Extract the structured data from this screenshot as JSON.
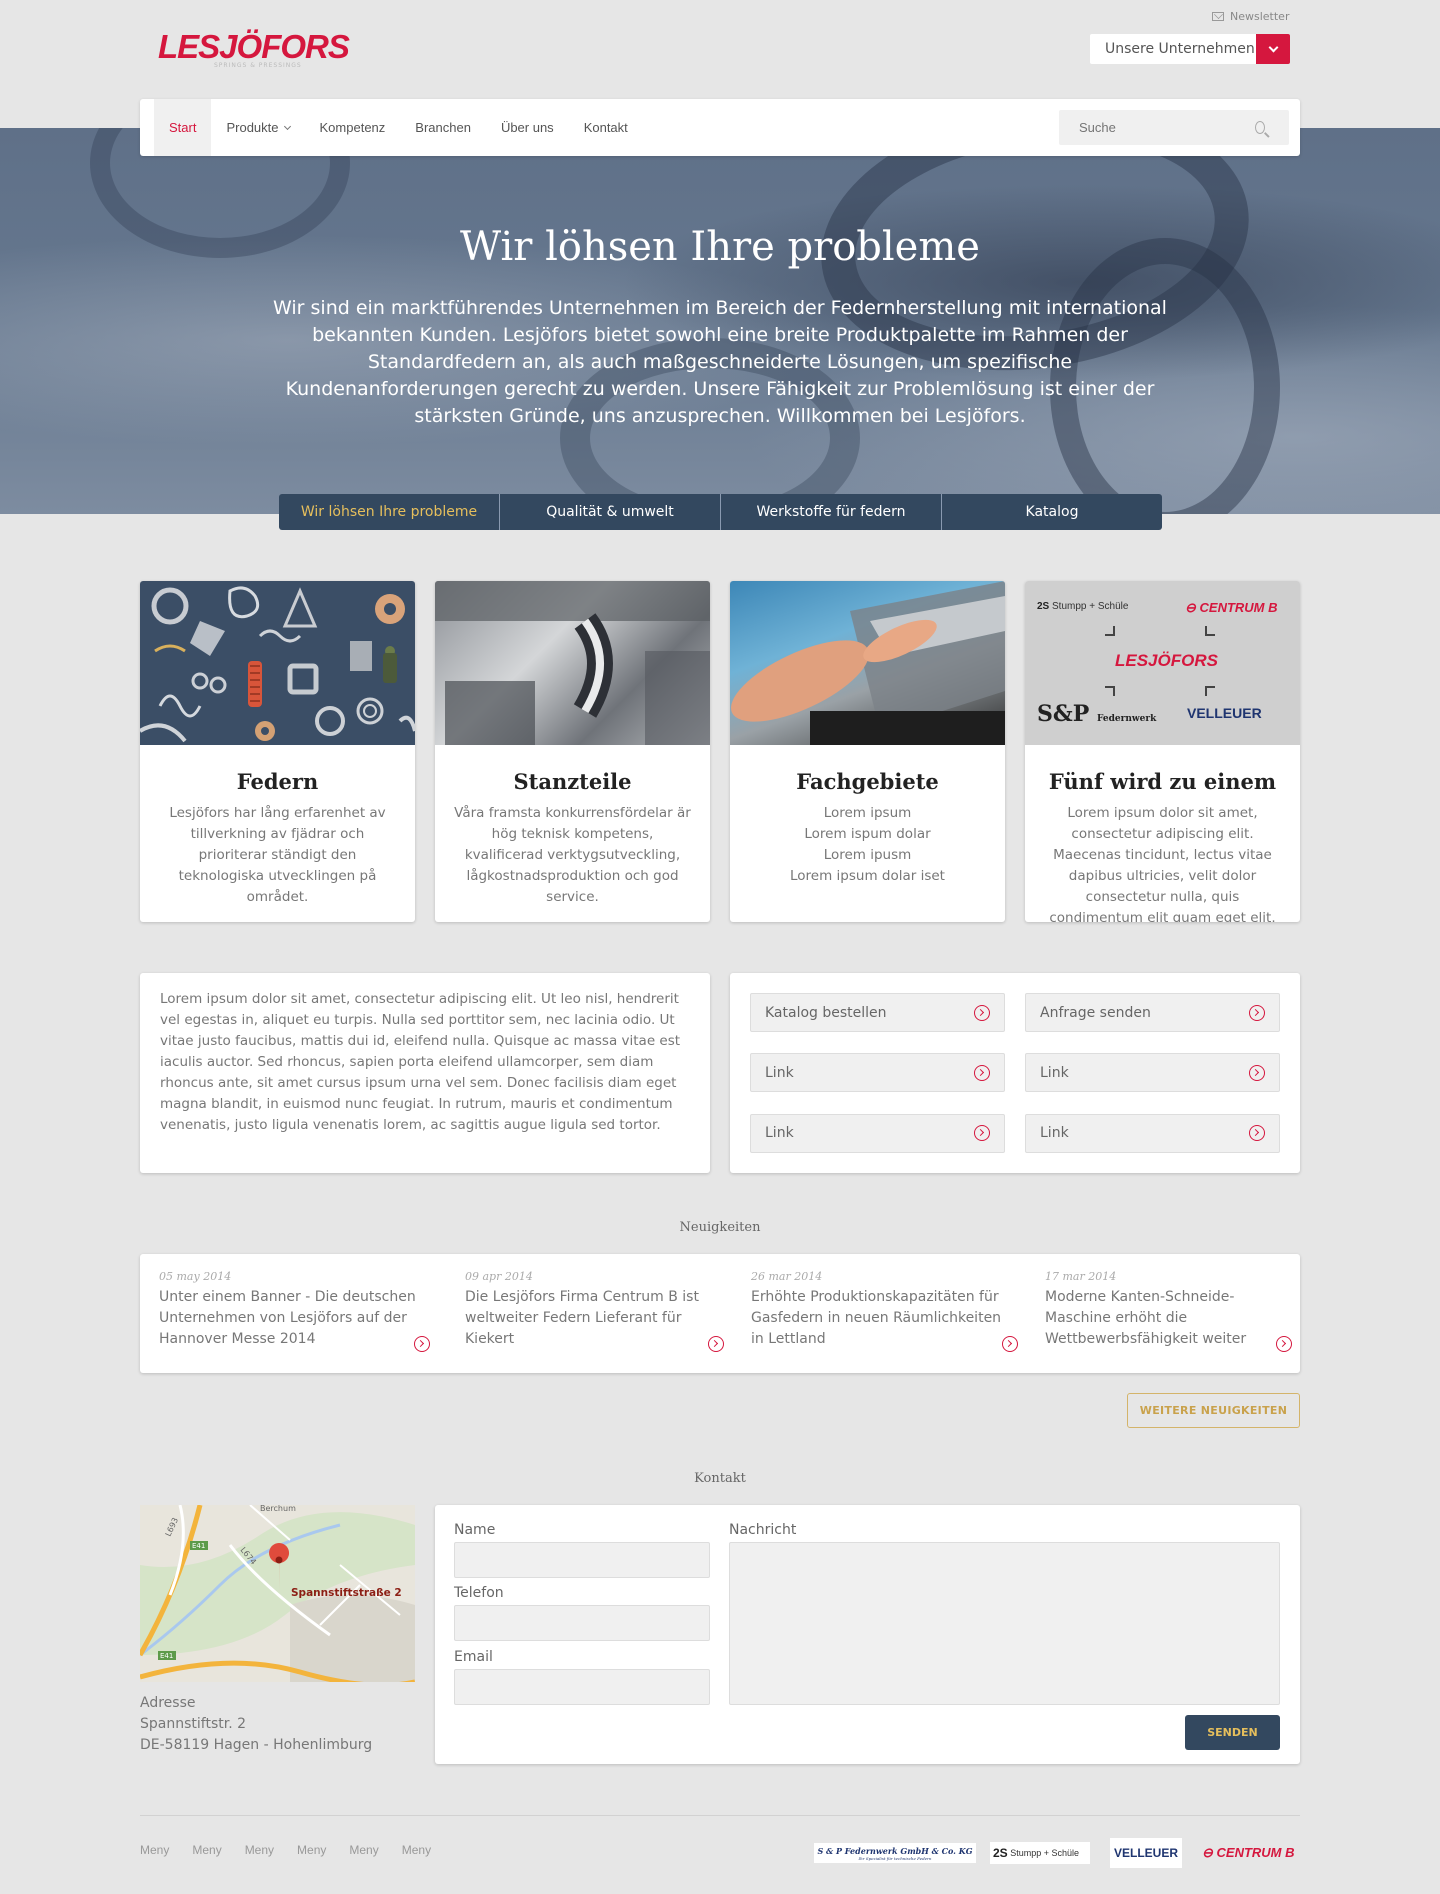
{
  "header": {
    "newsletter": "Newsletter",
    "logo_text": "LESJÖFORS",
    "logo_tagline": "SPRINGS & PRESSINGS",
    "companies_label": "Unsere Unternehmen"
  },
  "nav": {
    "items": [
      {
        "label": "Start",
        "active": true
      },
      {
        "label": "Produkte",
        "dropdown": true
      },
      {
        "label": "Kompetenz"
      },
      {
        "label": "Branchen"
      },
      {
        "label": "Über uns"
      },
      {
        "label": "Kontakt"
      }
    ],
    "search_placeholder": "Suche"
  },
  "hero": {
    "title": "Wir löhsen Ihre probleme",
    "text": "Wir sind ein marktführendes Unternehmen im Bereich der Federnherstellung mit international bekannten Kunden. Lesjöfors bietet sowohl eine breite Produktpalette im Rahmen der Standardfedern an, als auch maßgeschneiderte Lösungen, um spezifische Kundenanforderungen gerecht zu werden. Unsere Fähigkeit zur Problemlösung ist einer der stärksten Gründe, uns anzusprechen. Willkommen bei Lesjöfors.",
    "tabs": [
      "Wir löhsen Ihre probleme",
      "Qualität & umwelt",
      "Werkstoffe für federn",
      "Katalog"
    ]
  },
  "cards": [
    {
      "title": "Federn",
      "text": "Lesjöfors har lång erfarenhet av tillverkning av fjädrar och prioriterar ständigt den teknologiska utvecklingen på området."
    },
    {
      "title": "Stanzteile",
      "text": "Våra framsta konkurrensfördelar är hög teknisk kompetens, kvalificerad verktygsutveckling, lågkostnadsproduktion och god service."
    },
    {
      "title": "Fachgebiete",
      "text": "Lorem ipsum\nLorem ispum dolar\nLorem ipusm\nLorem ipsum dolar iset"
    },
    {
      "title": "Fünf wird zu einem",
      "text": "Lorem ipsum dolor sit amet, consectetur adipiscing elit. Maecenas tincidunt, lectus vitae dapibus ultricies, velit dolor consectetur nulla, quis condimentum elit quam eget elit."
    }
  ],
  "group_logos": {
    "stumpp": "Stumpp + Schüle",
    "centrum": "CENTRUM B",
    "lesjofors": "LESJÖFORS",
    "sp": "S&P",
    "sp_sub": "Federnwerk",
    "velleuer": "VELLEUER"
  },
  "info": {
    "text": "Lorem ipsum dolor sit amet, consectetur adipiscing elit. Ut leo nisl, hendrerit vel egestas in, aliquet eu turpis. Nulla sed porttitor sem, nec lacinia odio. Ut vitae justo faucibus, mattis dui id, eleifend nulla. Quisque ac massa vitae est iaculis auctor. Sed rhoncus, sapien porta eleifend ullamcorper, sem diam rhoncus ante, sit amet cursus ipsum urna vel sem. Donec facilisis diam eget magna blandit, in euismod nunc feugiat. In rutrum, mauris et condimentum venenatis, justo ligula venenatis lorem, ac sagittis augue ligula sed tortor.",
    "links": [
      "Katalog bestellen",
      "Anfrage senden",
      "Link",
      "Link",
      "Link",
      "Link"
    ]
  },
  "news": {
    "title": "Neuigkeiten",
    "items": [
      {
        "date": "05 may 2014",
        "text": "Unter einem Banner - Die deutschen Unternehmen von Lesjöfors auf der Hannover Messe 2014"
      },
      {
        "date": "09 apr 2014",
        "text": "Die Lesjöfors Firma Centrum B ist weltweiter Federn Lieferant für Kiekert"
      },
      {
        "date": "26 mar 2014",
        "text": "Erhöhte Produktionskapazitäten für Gasfedern in neuen Räumlichkeiten in Lettland"
      },
      {
        "date": "17 mar 2014",
        "text": "Moderne Kanten-Schneide-Maschine erhöht die Wettbewerbsfähigkeit weiter"
      }
    ],
    "more_label": "WEITERE NEUIGKEITEN"
  },
  "contact": {
    "title": "Kontakt",
    "map": {
      "marker_label": "Spannstiftstraße 2",
      "place": "Berchum",
      "road1": "L693",
      "road2": "L674",
      "motorway": "E41"
    },
    "address_label": "Adresse",
    "address_line1": "Spannstiftstr. 2",
    "address_line2": "DE-58119 Hagen - Hohenlimburg",
    "name_label": "Name",
    "phone_label": "Telefon",
    "email_label": "Email",
    "message_label": "Nachricht",
    "send_label": "SENDEN"
  },
  "footer": {
    "menu": [
      "Meny",
      "Meny",
      "Meny",
      "Meny",
      "Meny",
      "Meny"
    ],
    "logos": {
      "sp_name": "S & P Federnwerk GmbH & Co. KG",
      "sp_sub": "Ihr Spezialist für technische Federn",
      "stumpp": "Stumpp + Schüle",
      "velleuer": "VELLEUER",
      "centrum": "CENTRUM B"
    }
  },
  "colors": {
    "brand_red": "#d5173e",
    "navy": "#33485f",
    "gold": "#e6bf5c"
  }
}
